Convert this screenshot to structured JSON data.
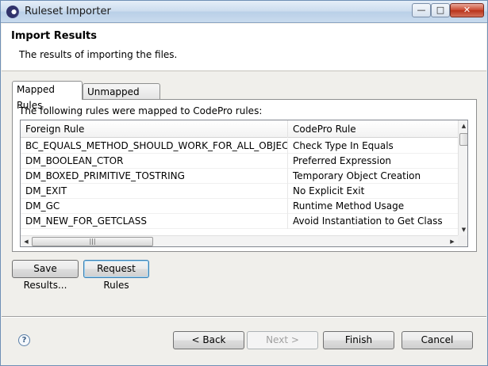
{
  "window": {
    "title": "Ruleset Importer",
    "minimize_glyph": "—",
    "maximize_glyph": "□",
    "close_glyph": "✕"
  },
  "header": {
    "title": "Import Results",
    "description": "The results of importing the files."
  },
  "tabs": [
    {
      "label": "Mapped Rules",
      "selected": true
    },
    {
      "label": "Unmapped Rules",
      "selected": false
    }
  ],
  "mapped_panel": {
    "intro": "The following rules were mapped to CodePro rules:",
    "columns": [
      "Foreign Rule",
      "CodePro Rule"
    ],
    "rows": [
      {
        "foreign": "BC_EQUALS_METHOD_SHOULD_WORK_FOR_ALL_OBJECTS",
        "codepro": "Check Type In Equals"
      },
      {
        "foreign": "DM_BOOLEAN_CTOR",
        "codepro": "Preferred Expression"
      },
      {
        "foreign": "DM_BOXED_PRIMITIVE_TOSTRING",
        "codepro": "Temporary Object Creation"
      },
      {
        "foreign": "DM_EXIT",
        "codepro": "No Explicit Exit"
      },
      {
        "foreign": "DM_GC",
        "codepro": "Runtime Method Usage"
      },
      {
        "foreign": "DM_NEW_FOR_GETCLASS",
        "codepro": "Avoid Instantiation to Get Class"
      }
    ],
    "scroll": {
      "up": "▲",
      "down": "▼",
      "left": "◀",
      "right": "▶",
      "grip": "|||"
    }
  },
  "actions": {
    "save_results": "Save Results...",
    "request_rules": "Request Rules"
  },
  "footer": {
    "help_glyph": "?",
    "back": "< Back",
    "next": "Next >",
    "finish": "Finish",
    "cancel": "Cancel"
  }
}
